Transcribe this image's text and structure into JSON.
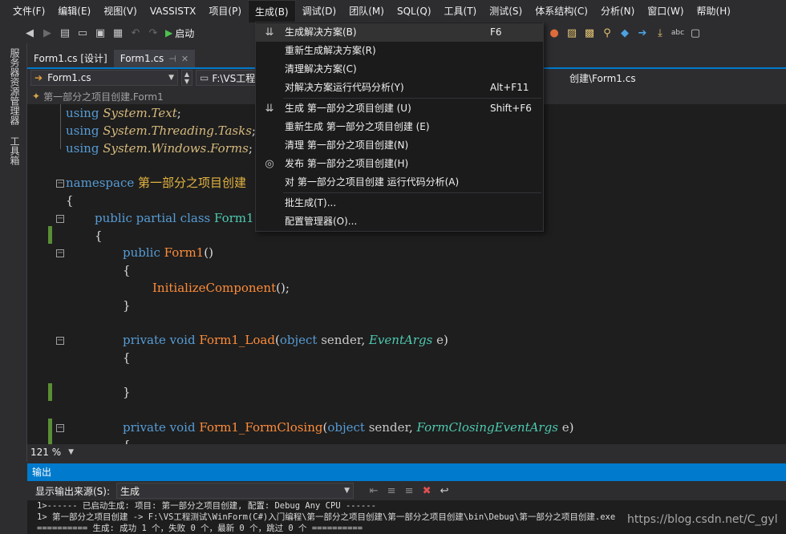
{
  "menu": {
    "items": [
      "文件(F)",
      "编辑(E)",
      "视图(V)",
      "VASSISTX",
      "项目(P)",
      "生成(B)",
      "调试(D)",
      "团队(M)",
      "SQL(Q)",
      "工具(T)",
      "测试(S)",
      "体系结构(C)",
      "分析(N)",
      "窗口(W)",
      "帮助(H)"
    ]
  },
  "toolbar": {
    "start_label": "启动"
  },
  "sidebar": {
    "tab1": "服务器资源管理器",
    "tab2": "工具箱"
  },
  "tabs": [
    {
      "label": "Form1.cs [设计]"
    },
    {
      "label": "Form1.cs"
    }
  ],
  "nav": {
    "file_combo": "Form1.cs",
    "path_left": "F:\\VS工程",
    "path_right": "创建\\Form1.cs"
  },
  "breadcrumb": {
    "text": "第一部分之项目创建.Form1"
  },
  "code": {
    "l1_kw": "using",
    "l1_ns": "System.Text",
    "l2_kw": "using",
    "l2_ns": "System.Threading.Tasks",
    "l3_kw": "using",
    "l3_ns": "System.Windows.Forms",
    "ns_kw": "namespace",
    "ns_name": "第一部分之项目创建",
    "class_mods": "public partial class",
    "class_name": "Form1",
    "ctor_kw": "public",
    "ctor_name": "Form1",
    "init_call": "InitializeComponent",
    "load_mods": "private void",
    "load_name": "Form1_Load",
    "load_param1_type": "object",
    "load_param1_name": "sender",
    "load_param2_type": "EventArgs",
    "load_param2_name": "e",
    "closing_mods": "private void",
    "closing_name": "Form1_FormClosing",
    "closing_param1_type": "object",
    "closing_param1_name": "sender",
    "closing_param2_type": "FormClosingEventArgs",
    "closing_param2_name": "e"
  },
  "zoom": {
    "value": "121 %"
  },
  "output": {
    "title": "输出",
    "source_label": "显示输出来源(S):",
    "source_value": "生成",
    "lines": [
      "1>------ 已启动生成: 项目: 第一部分之项目创建, 配置: Debug Any CPU ------",
      "1>  第一部分之项目创建 -> F:\\VS工程测试\\WinForm(C#)入门编程\\第一部分之项目创建\\第一部分之项目创建\\bin\\Debug\\第一部分之项目创建.exe",
      "========== 生成: 成功 1 个，失败 0 个，最新 0 个，跳过 0 个 =========="
    ]
  },
  "watermark": "https://blog.csdn.net/C_gyl",
  "build_menu": {
    "items": [
      {
        "label": "生成解决方案(B)",
        "shortcut": "F6",
        "icon": "build-solution-icon"
      },
      {
        "label": "重新生成解决方案(R)",
        "shortcut": ""
      },
      {
        "label": "清理解决方案(C)",
        "shortcut": ""
      },
      {
        "label": "对解决方案运行代码分析(Y)",
        "shortcut": "Alt+F11"
      },
      {
        "label": "生成 第一部分之项目创建 (U)",
        "shortcut": "Shift+F6",
        "icon": "build-project-icon"
      },
      {
        "label": "重新生成 第一部分之项目创建 (E)",
        "shortcut": ""
      },
      {
        "label": "清理 第一部分之项目创建(N)",
        "shortcut": ""
      },
      {
        "label": "发布 第一部分之项目创建(H)",
        "shortcut": "",
        "icon": "publish-icon"
      },
      {
        "label": "对 第一部分之项目创建 运行代码分析(A)",
        "shortcut": ""
      },
      {
        "label": "批生成(T)...",
        "shortcut": ""
      },
      {
        "label": "配置管理器(O)...",
        "shortcut": ""
      }
    ]
  },
  "colors": {
    "accent": "#007acc",
    "background": "#2d2d30",
    "editor": "#1e1e1e",
    "menu": "#1b1b1c"
  }
}
